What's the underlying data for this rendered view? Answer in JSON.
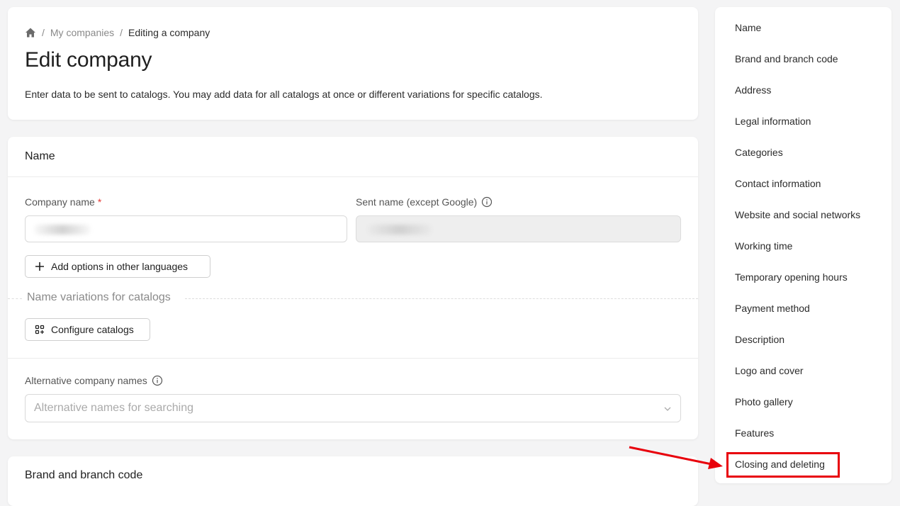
{
  "breadcrumb": {
    "home_icon": "home-icon",
    "items": [
      "My companies",
      "Editing a company"
    ],
    "separator": "/"
  },
  "header": {
    "title": "Edit company",
    "description": "Enter data to be sent to catalogs. You may add data for all catalogs at once or different variations for specific catalogs."
  },
  "name_section": {
    "title": "Name",
    "company_name_label": "Company name",
    "required_mark": "*",
    "sent_name_label": "Sent name (except Google)",
    "add_languages_button": "Add options in other languages",
    "variations_label": "Name variations for catalogs",
    "configure_catalogs_button": "Configure catalogs",
    "alt_names_label": "Alternative company names",
    "alt_names_placeholder": "Alternative names for searching"
  },
  "brand_section": {
    "title": "Brand and branch code"
  },
  "sidebar": {
    "items": [
      "Name",
      "Brand and branch code",
      "Address",
      "Legal information",
      "Categories",
      "Contact information",
      "Website and social networks",
      "Working time",
      "Temporary opening hours",
      "Payment method",
      "Description",
      "Logo and cover",
      "Photo gallery",
      "Features",
      "Closing and deleting"
    ],
    "highlighted_item": "Closing and deleting"
  },
  "colors": {
    "background": "#f4f4f5",
    "card": "#ffffff",
    "required": "#e53935",
    "annotation": "#e8000b"
  }
}
